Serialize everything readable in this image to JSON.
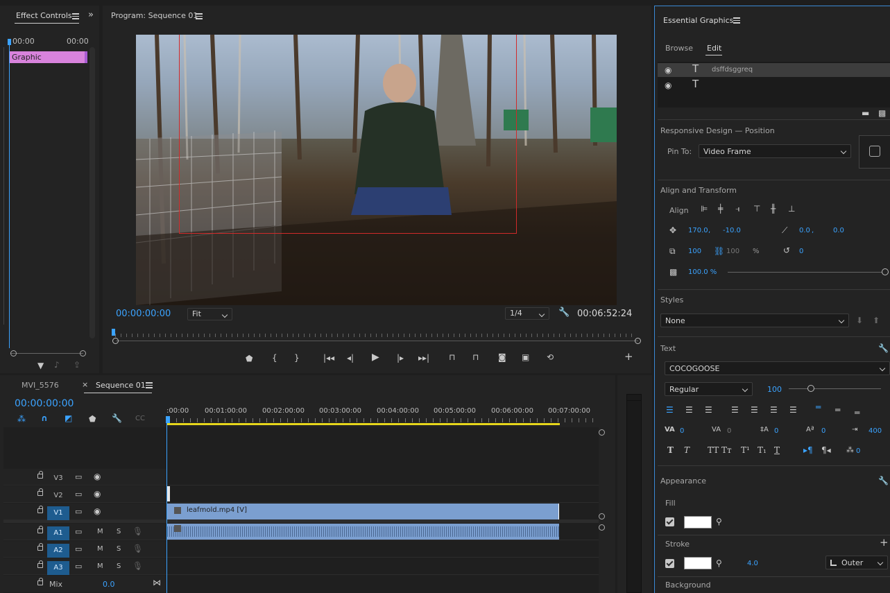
{
  "effect_controls": {
    "tab": "Effect Controls",
    "time_left": "00:00",
    "time_right": "00:00",
    "clip_label": "Graphic"
  },
  "program": {
    "title": "Program: Sequence 01",
    "timecode": "00:00:00:00",
    "zoom": "Fit",
    "resolution": "1/4",
    "duration": "00:06:52:24"
  },
  "timeline": {
    "tab_source": "MVI_5576",
    "tab_active": "Sequence 01",
    "timecode": "00:00:00:00",
    "ruler": [
      ":00:00",
      "00:01:00:00",
      "00:02:00:00",
      "00:03:00:00",
      "00:04:00:00",
      "00:05:00:00",
      "00:06:00:00",
      "00:07:00:00"
    ],
    "tracks": [
      {
        "name": "V3",
        "type": "video",
        "active": false
      },
      {
        "name": "V2",
        "type": "video",
        "active": false
      },
      {
        "name": "V1",
        "type": "video",
        "active": true
      },
      {
        "name": "A1",
        "type": "audio",
        "active": true
      },
      {
        "name": "A2",
        "type": "audio",
        "active": true
      },
      {
        "name": "A3",
        "type": "audio",
        "active": true
      }
    ],
    "m_label": "M",
    "s_label": "S",
    "mix_label": "Mix",
    "mix_value": "0.0",
    "video_clip": "leafmold.mp4 [V]"
  },
  "essential_graphics": {
    "title": "Essential Graphics",
    "tab_browse": "Browse",
    "tab_edit": "Edit",
    "layers": [
      {
        "name": "dsffdsggreq",
        "type": "text",
        "selected": true
      },
      {
        "name": "",
        "type": "text",
        "selected": false
      }
    ],
    "responsive_title": "Responsive Design — Position",
    "pin_to_label": "Pin To:",
    "pin_to_value": "Video Frame",
    "align_title": "Align and Transform",
    "align_label": "Align",
    "pos_x": "170.0",
    "pos_sep": ",",
    "pos_y": "-10.0",
    "anchor_x": "0.0",
    "anchor_sep": ",",
    "anchor_y": "0.0",
    "scale": "100",
    "scale_h": "100",
    "percent": "%",
    "rotation": "0",
    "opacity": "100.0 %",
    "styles_title": "Styles",
    "style_value": "None",
    "text_title": "Text",
    "font": "COCOGOOSE",
    "font_style": "Regular",
    "font_size": "100",
    "tracking_values": [
      "0",
      "0",
      "0",
      "0",
      "400"
    ],
    "baseline_value": "0",
    "appearance_title": "Appearance",
    "fill_label": "Fill",
    "stroke_label": "Stroke",
    "stroke_width": "4.0",
    "stroke_type": "Outer",
    "background_label": "Background",
    "accent": "#3ba3ff"
  }
}
